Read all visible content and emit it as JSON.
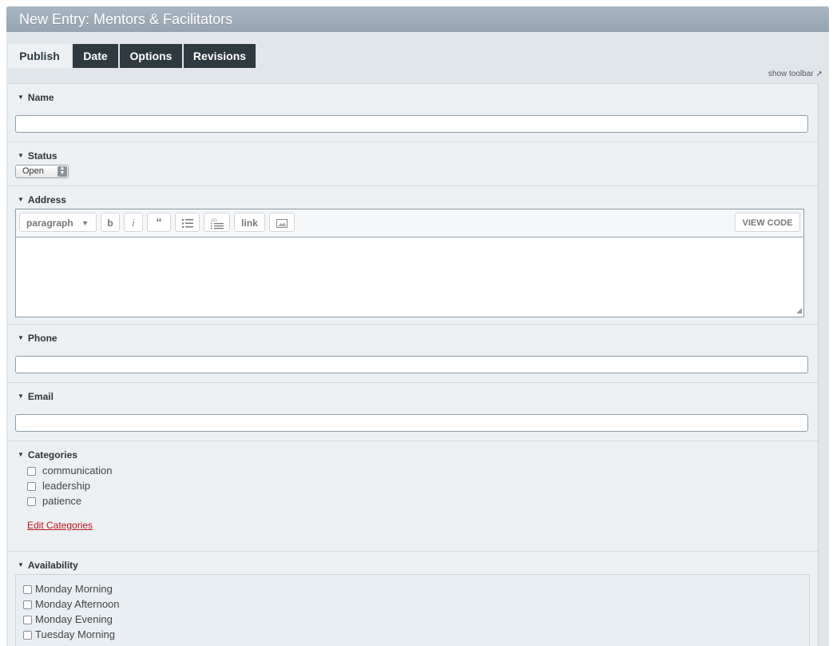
{
  "window": {
    "title": "New Entry: Mentors & Facilitators"
  },
  "tabs": [
    {
      "label": "Publish",
      "active": true
    },
    {
      "label": "Date",
      "active": false
    },
    {
      "label": "Options",
      "active": false
    },
    {
      "label": "Revisions",
      "active": false
    }
  ],
  "toolbar_toggle": {
    "label": "show toolbar",
    "icon": "arrow-up-right-icon"
  },
  "fields": {
    "name": {
      "label": "Name",
      "value": ""
    },
    "status": {
      "label": "Status",
      "value": "Open"
    },
    "address": {
      "label": "Address",
      "value": "",
      "toolbar": {
        "format_select": "paragraph",
        "bold": "b",
        "italic": "i",
        "quote": "“",
        "link": "link",
        "view_code": "VIEW CODE"
      }
    },
    "phone": {
      "label": "Phone",
      "value": ""
    },
    "email": {
      "label": "Email",
      "value": ""
    },
    "categories": {
      "label": "Categories",
      "items": [
        "communication",
        "leadership",
        "patience"
      ],
      "edit_link": "Edit Categories"
    },
    "availability": {
      "label": "Availability",
      "items": [
        "Monday Morning",
        "Monday Afternoon",
        "Monday Evening",
        "Tuesday Morning"
      ]
    }
  },
  "colors": {
    "title_bar": "#9fadb8",
    "tab_dark": "#2e3940",
    "tab_active": "#eef1f4",
    "link_red": "#c0141e"
  }
}
